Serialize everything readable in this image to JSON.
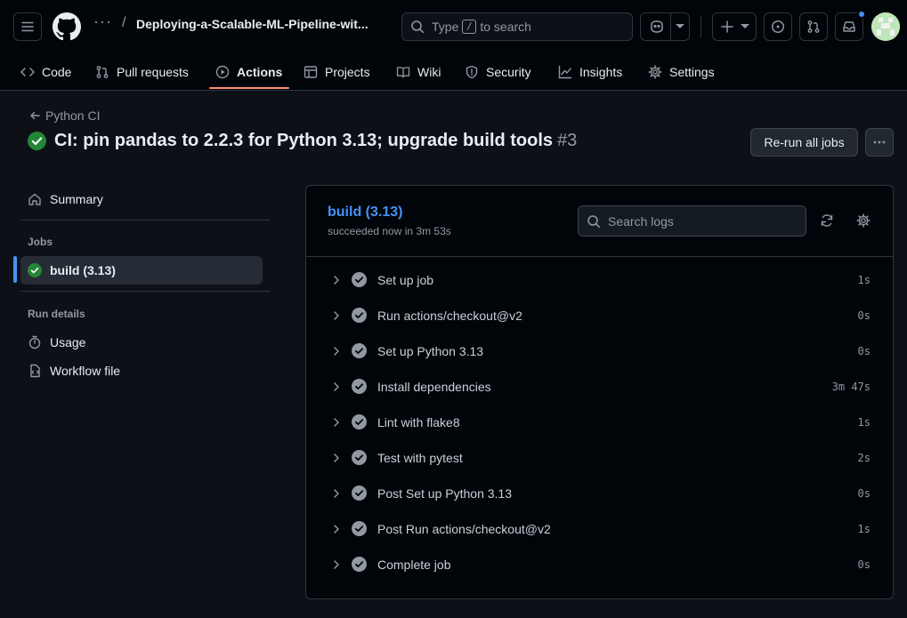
{
  "header": {
    "repo_name": "Deploying-a-Scalable-ML-Pipeline-wit...",
    "breadcrumb_dots": "···",
    "breadcrumb_separator": "/",
    "search": {
      "prefix": "Type",
      "key": "/",
      "suffix": "to search"
    }
  },
  "nav": {
    "items": [
      {
        "label": "Code",
        "icon": "code-icon"
      },
      {
        "label": "Pull requests",
        "icon": "git-pull-request-icon"
      },
      {
        "label": "Actions",
        "icon": "play-icon",
        "active": true
      },
      {
        "label": "Projects",
        "icon": "table-icon"
      },
      {
        "label": "Wiki",
        "icon": "book-icon"
      },
      {
        "label": "Security",
        "icon": "shield-icon"
      },
      {
        "label": "Insights",
        "icon": "graph-icon"
      },
      {
        "label": "Settings",
        "icon": "gear-icon"
      }
    ]
  },
  "run": {
    "back_label": "Python CI",
    "title": "CI: pin pandas to 2.2.3 for Python 3.13; upgrade build tools",
    "number": "#3",
    "rerun_label": "Re-run all jobs"
  },
  "sidebar": {
    "summary_label": "Summary",
    "jobs_heading": "Jobs",
    "job_label": "build (3.13)",
    "run_details_heading": "Run details",
    "usage_label": "Usage",
    "workflow_file_label": "Workflow file"
  },
  "job": {
    "name": "build (3.13)",
    "status": "succeeded now in 3m 53s",
    "search_placeholder": "Search logs",
    "steps": [
      {
        "name": "Set up job",
        "duration": "1s"
      },
      {
        "name": "Run actions/checkout@v2",
        "duration": "0s"
      },
      {
        "name": "Set up Python 3.13",
        "duration": "0s"
      },
      {
        "name": "Install dependencies",
        "duration": "3m 47s"
      },
      {
        "name": "Lint with flake8",
        "duration": "1s"
      },
      {
        "name": "Test with pytest",
        "duration": "2s"
      },
      {
        "name": "Post Set up Python 3.13",
        "duration": "0s"
      },
      {
        "name": "Post Run actions/checkout@v2",
        "duration": "1s"
      },
      {
        "name": "Complete job",
        "duration": "0s"
      }
    ]
  },
  "colors": {
    "success": "#238636",
    "link": "#4493f8",
    "nav_underline": "#fd8c73",
    "notification_dot": "#4493f8"
  }
}
